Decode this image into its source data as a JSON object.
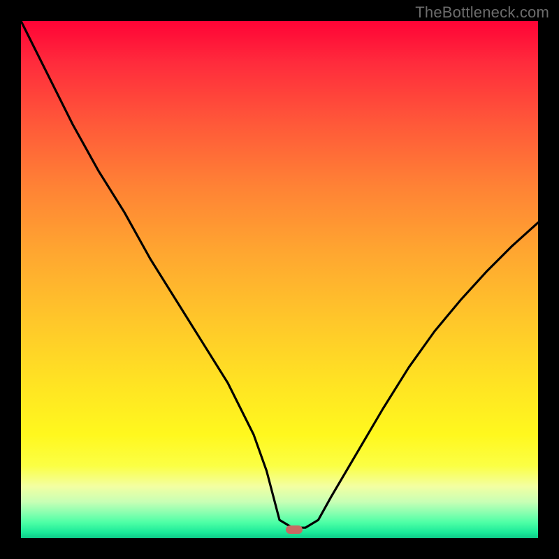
{
  "watermark": "TheBottleneck.com",
  "marker": {
    "x_frac": 0.528,
    "y_frac": 0.984
  },
  "chart_data": {
    "type": "line",
    "title": "",
    "xlabel": "",
    "ylabel": "",
    "xlim": [
      0,
      1
    ],
    "ylim": [
      0,
      1
    ],
    "series": [
      {
        "name": "bottleneck-curve",
        "x": [
          0.0,
          0.05,
          0.1,
          0.15,
          0.2,
          0.25,
          0.3,
          0.35,
          0.4,
          0.45,
          0.475,
          0.5,
          0.525,
          0.55,
          0.575,
          0.6,
          0.65,
          0.7,
          0.75,
          0.8,
          0.85,
          0.9,
          0.95,
          1.0
        ],
        "y": [
          1.0,
          0.9,
          0.8,
          0.71,
          0.63,
          0.54,
          0.46,
          0.38,
          0.3,
          0.2,
          0.13,
          0.035,
          0.02,
          0.02,
          0.035,
          0.08,
          0.165,
          0.25,
          0.33,
          0.4,
          0.46,
          0.515,
          0.565,
          0.61
        ]
      }
    ],
    "bottleneck_marker": {
      "x": 0.528,
      "y": 0.016
    },
    "gradient_stops": [
      {
        "pos": 0.0,
        "color": "#ff0336"
      },
      {
        "pos": 0.5,
        "color": "#ffc72a"
      },
      {
        "pos": 0.82,
        "color": "#fff81e"
      },
      {
        "pos": 1.0,
        "color": "#0fc988"
      }
    ]
  }
}
